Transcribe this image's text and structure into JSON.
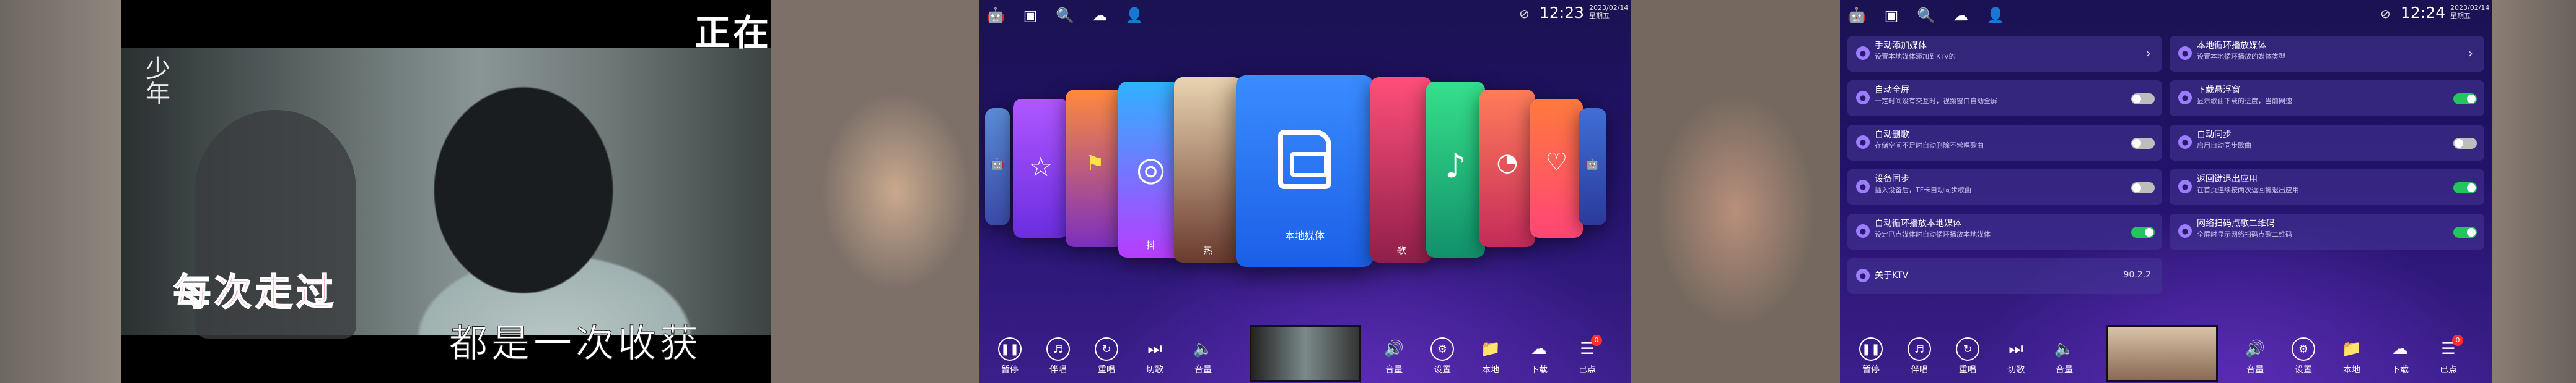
{
  "panel1": {
    "logo_text": "少年",
    "top_lyric": "正在",
    "lyric_line1": "每次走过",
    "lyric_line2": "都是一次收获"
  },
  "panel2": {
    "time": "12:23",
    "date": "2023/02/14",
    "weekday": "星期五",
    "side_cards": [
      {
        "label": "抖"
      },
      {
        "label": "热"
      },
      {
        "label": "歌"
      }
    ],
    "center_card": {
      "label": "本地媒体"
    }
  },
  "panel3": {
    "time": "12:24",
    "date": "2023/02/14",
    "weekday": "星期五",
    "settings_left": [
      {
        "title": "手动添加媒体",
        "desc": "设置本地媒体添加到KTV的",
        "control": "arrow"
      },
      {
        "title": "自动全屏",
        "desc": "一定时间没有交互时，视频窗口自动全屏",
        "control": "off"
      },
      {
        "title": "自动删歌",
        "desc": "存储空间不足时自动删除不常唱歌曲",
        "control": "off"
      },
      {
        "title": "设备同步",
        "desc": "插入设备后，TF卡自动同步歌曲",
        "control": "off"
      },
      {
        "title": "自动循环播放本地媒体",
        "desc": "设定已点媒体时自动循环播放本地媒体",
        "control": "on"
      },
      {
        "title": "关于KTV",
        "desc": "",
        "control": "version",
        "value": "90.2.2"
      }
    ],
    "settings_right": [
      {
        "title": "本地循环播放媒体",
        "desc": "设置本地循环播放的媒体类型",
        "control": "arrow"
      },
      {
        "title": "下载悬浮窗",
        "desc": "显示歌曲下载的进度，当前网速",
        "control": "on"
      },
      {
        "title": "自动同步",
        "desc": "启用自动同步歌曲",
        "control": "off"
      },
      {
        "title": "返回键退出应用",
        "desc": "在首页连续按两次返回键退出应用",
        "control": "on"
      },
      {
        "title": "网络扫码点歌二维码",
        "desc": "全屏时显示网络扫码点歌二维码",
        "control": "on"
      }
    ]
  },
  "bottom": {
    "left": [
      "暂停",
      "伴唱",
      "重唱",
      "切歌",
      "音量"
    ],
    "right": [
      "音量",
      "设置",
      "本地",
      "下载",
      "已点"
    ],
    "badge": "0"
  },
  "colors": {
    "accent": "#3a8cff",
    "toggle_on": "#22c55e",
    "bg": "#23126a"
  }
}
